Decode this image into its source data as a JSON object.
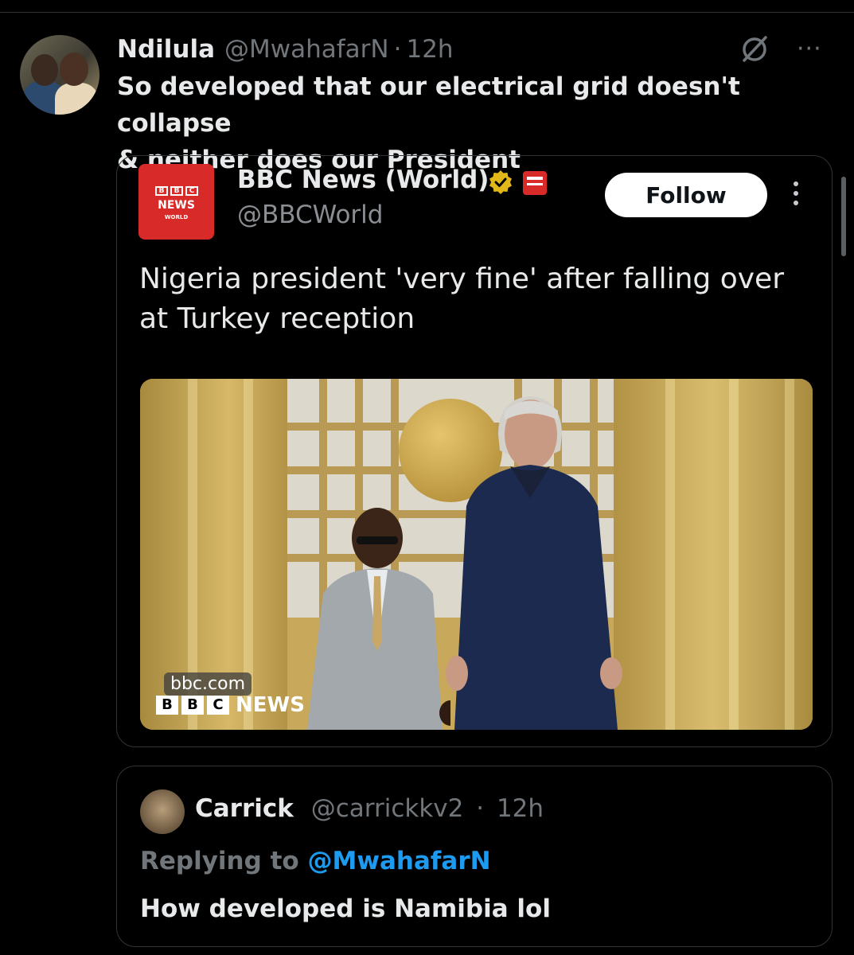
{
  "tweet": {
    "author_name": "Ndilula",
    "author_handle": "@MwahafarN",
    "separator": "·",
    "time": "12h",
    "more_icon": "···",
    "text_line1": "So developed that our electrical grid doesn't collapse",
    "text_line2": "& neither does our President"
  },
  "quoted": {
    "logo_blocks": [
      "B",
      "B",
      "C"
    ],
    "logo_news": "NEWS",
    "logo_world": "WORLD",
    "name": "BBC News (World)",
    "handle": "@BBCWorld",
    "follow_label": "Follow",
    "headline": "Nigeria president 'very fine' after falling over at Turkey reception",
    "image_watermark_domain": "bbc.com",
    "image_watermark_blocks": [
      "B",
      "B",
      "C"
    ],
    "image_watermark_news": "NEWS"
  },
  "reply": {
    "author_name": "Carrick",
    "author_handle": "@carrickkv2",
    "separator": "·",
    "time": "12h",
    "replying_prefix": "Replying to",
    "replying_to": "@MwahafarN",
    "text": "How developed is Namibia lol"
  },
  "colors": {
    "background": "#000000",
    "secondary_text": "#71767b",
    "mention": "#1d9bf0",
    "bbc_red": "#d82b29",
    "verified_gold": "#e2b719"
  }
}
